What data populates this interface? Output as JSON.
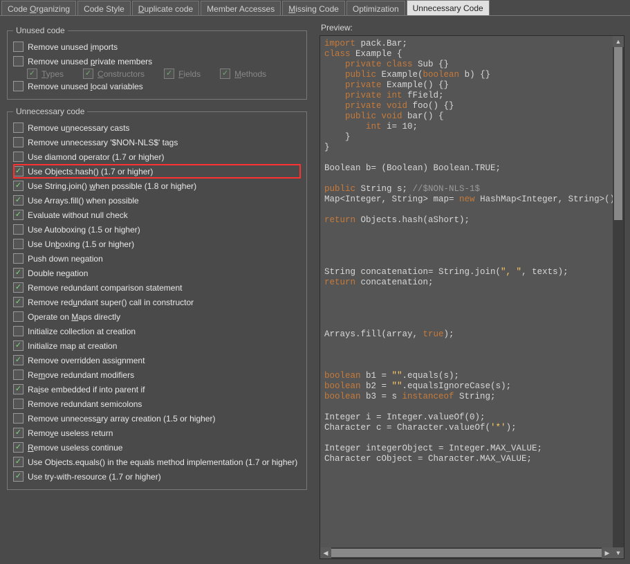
{
  "tabs": [
    {
      "label": "Code Organizing",
      "mn": "O",
      "active": false
    },
    {
      "label": "Code Style",
      "mn": "",
      "active": false
    },
    {
      "label": "Duplicate code",
      "mn": "D",
      "active": false
    },
    {
      "label": "Member Accesses",
      "mn": "",
      "active": false
    },
    {
      "label": "Missing Code",
      "mn": "M",
      "active": false
    },
    {
      "label": "Optimization",
      "mn": "",
      "active": false
    },
    {
      "label": "Unnecessary Code",
      "mn": "",
      "active": true
    }
  ],
  "unused": {
    "legend": "Unused code",
    "items": [
      {
        "label": "Remove unused imports",
        "checked": false,
        "mn": "i"
      },
      {
        "label": "Remove unused private members",
        "checked": false,
        "mn": "p"
      }
    ],
    "subs": [
      {
        "label": "Types",
        "checked": true,
        "disabled": true,
        "mn": "T"
      },
      {
        "label": "Constructors",
        "checked": true,
        "disabled": true,
        "mn": "C"
      },
      {
        "label": "Fields",
        "checked": true,
        "disabled": true,
        "mn": "F"
      },
      {
        "label": "Methods",
        "checked": true,
        "disabled": true,
        "mn": "M"
      }
    ],
    "last": {
      "label": "Remove unused local variables",
      "checked": false,
      "mn": "l"
    }
  },
  "unnecessary": {
    "legend": "Unnecessary code",
    "items": [
      {
        "label": "Remove unnecessary casts",
        "checked": false,
        "mn": "n",
        "hl": false
      },
      {
        "label": "Remove unnecessary '$NON-NLS$' tags",
        "checked": false,
        "mn": "",
        "hl": false
      },
      {
        "label": "Use diamond operator (1.7 or higher)",
        "checked": false,
        "mn": "",
        "hl": false
      },
      {
        "label": "Use Objects.hash() (1.7 or higher)",
        "checked": true,
        "mn": "",
        "hl": true
      },
      {
        "label": "Use String.join() when possible (1.8 or higher)",
        "checked": true,
        "mn": "w",
        "hl": false
      },
      {
        "label": "Use Arrays.fill() when possible",
        "checked": true,
        "mn": "",
        "hl": false
      },
      {
        "label": "Evaluate without null check",
        "checked": true,
        "mn": "",
        "hl": false
      },
      {
        "label": "Use Autoboxing (1.5 or higher)",
        "checked": false,
        "mn": "",
        "hl": false
      },
      {
        "label": "Use Unboxing (1.5 or higher)",
        "checked": false,
        "mn": "b",
        "hl": false
      },
      {
        "label": "Push down negation",
        "checked": false,
        "mn": "",
        "hl": false
      },
      {
        "label": "Double negation",
        "checked": true,
        "mn": "",
        "hl": false
      },
      {
        "label": "Remove redundant comparison statement",
        "checked": true,
        "mn": "",
        "hl": false
      },
      {
        "label": "Remove redundant super() call in constructor",
        "checked": true,
        "mn": "u",
        "hl": false
      },
      {
        "label": "Operate on Maps directly",
        "checked": false,
        "mn": "M",
        "hl": false
      },
      {
        "label": "Initialize collection at creation",
        "checked": false,
        "mn": "",
        "hl": false
      },
      {
        "label": "Initialize map at creation",
        "checked": true,
        "mn": "",
        "hl": false
      },
      {
        "label": "Remove overridden assignment",
        "checked": true,
        "mn": "",
        "hl": false
      },
      {
        "label": "Remove redundant modifiers",
        "checked": false,
        "mn": "m",
        "hl": false
      },
      {
        "label": "Raise embedded if into parent if",
        "checked": true,
        "mn": "i",
        "hl": false
      },
      {
        "label": "Remove redundant semicolons",
        "checked": false,
        "mn": "",
        "hl": false
      },
      {
        "label": "Remove unnecessary array creation (1.5 or higher)",
        "checked": false,
        "mn": "a",
        "hl": false
      },
      {
        "label": "Remove useless return",
        "checked": true,
        "mn": "v",
        "hl": false
      },
      {
        "label": "Remove useless continue",
        "checked": true,
        "mn": "R",
        "hl": false
      },
      {
        "label": "Use Objects.equals() in the equals method implementation (1.7 or higher)",
        "checked": true,
        "mn": "",
        "hl": false
      },
      {
        "label": "Use try-with-resource (1.7 or higher)",
        "checked": true,
        "mn": "",
        "hl": false
      }
    ]
  },
  "preview": {
    "label": "Preview:"
  }
}
